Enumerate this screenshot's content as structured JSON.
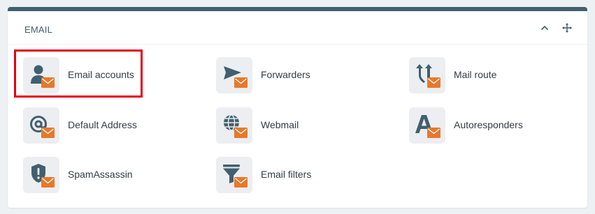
{
  "section": {
    "title": "EMAIL"
  },
  "header_controls": {
    "collapse_icon": "chevron-up-icon",
    "move_icon": "move-arrows-icon"
  },
  "colors": {
    "accent": "#41606f",
    "envelope": "#e8782a",
    "highlight": "#e3000f",
    "tile": "#eceef1"
  },
  "items": [
    {
      "label": "Email accounts",
      "icon": "user-mail-icon"
    },
    {
      "label": "Forwarders",
      "icon": "send-mail-icon"
    },
    {
      "label": "Mail route",
      "icon": "route-arrows-mail-icon"
    },
    {
      "label": "Default Address",
      "icon": "at-sign-mail-icon"
    },
    {
      "label": "Webmail",
      "icon": "globe-mail-icon"
    },
    {
      "label": "Autoresponders",
      "icon": "autorespond-a-mail-icon"
    },
    {
      "label": "SpamAssassin",
      "icon": "shield-mail-icon"
    },
    {
      "label": "Email filters",
      "icon": "funnel-mail-icon"
    }
  ],
  "highlighted_item": "Email accounts"
}
